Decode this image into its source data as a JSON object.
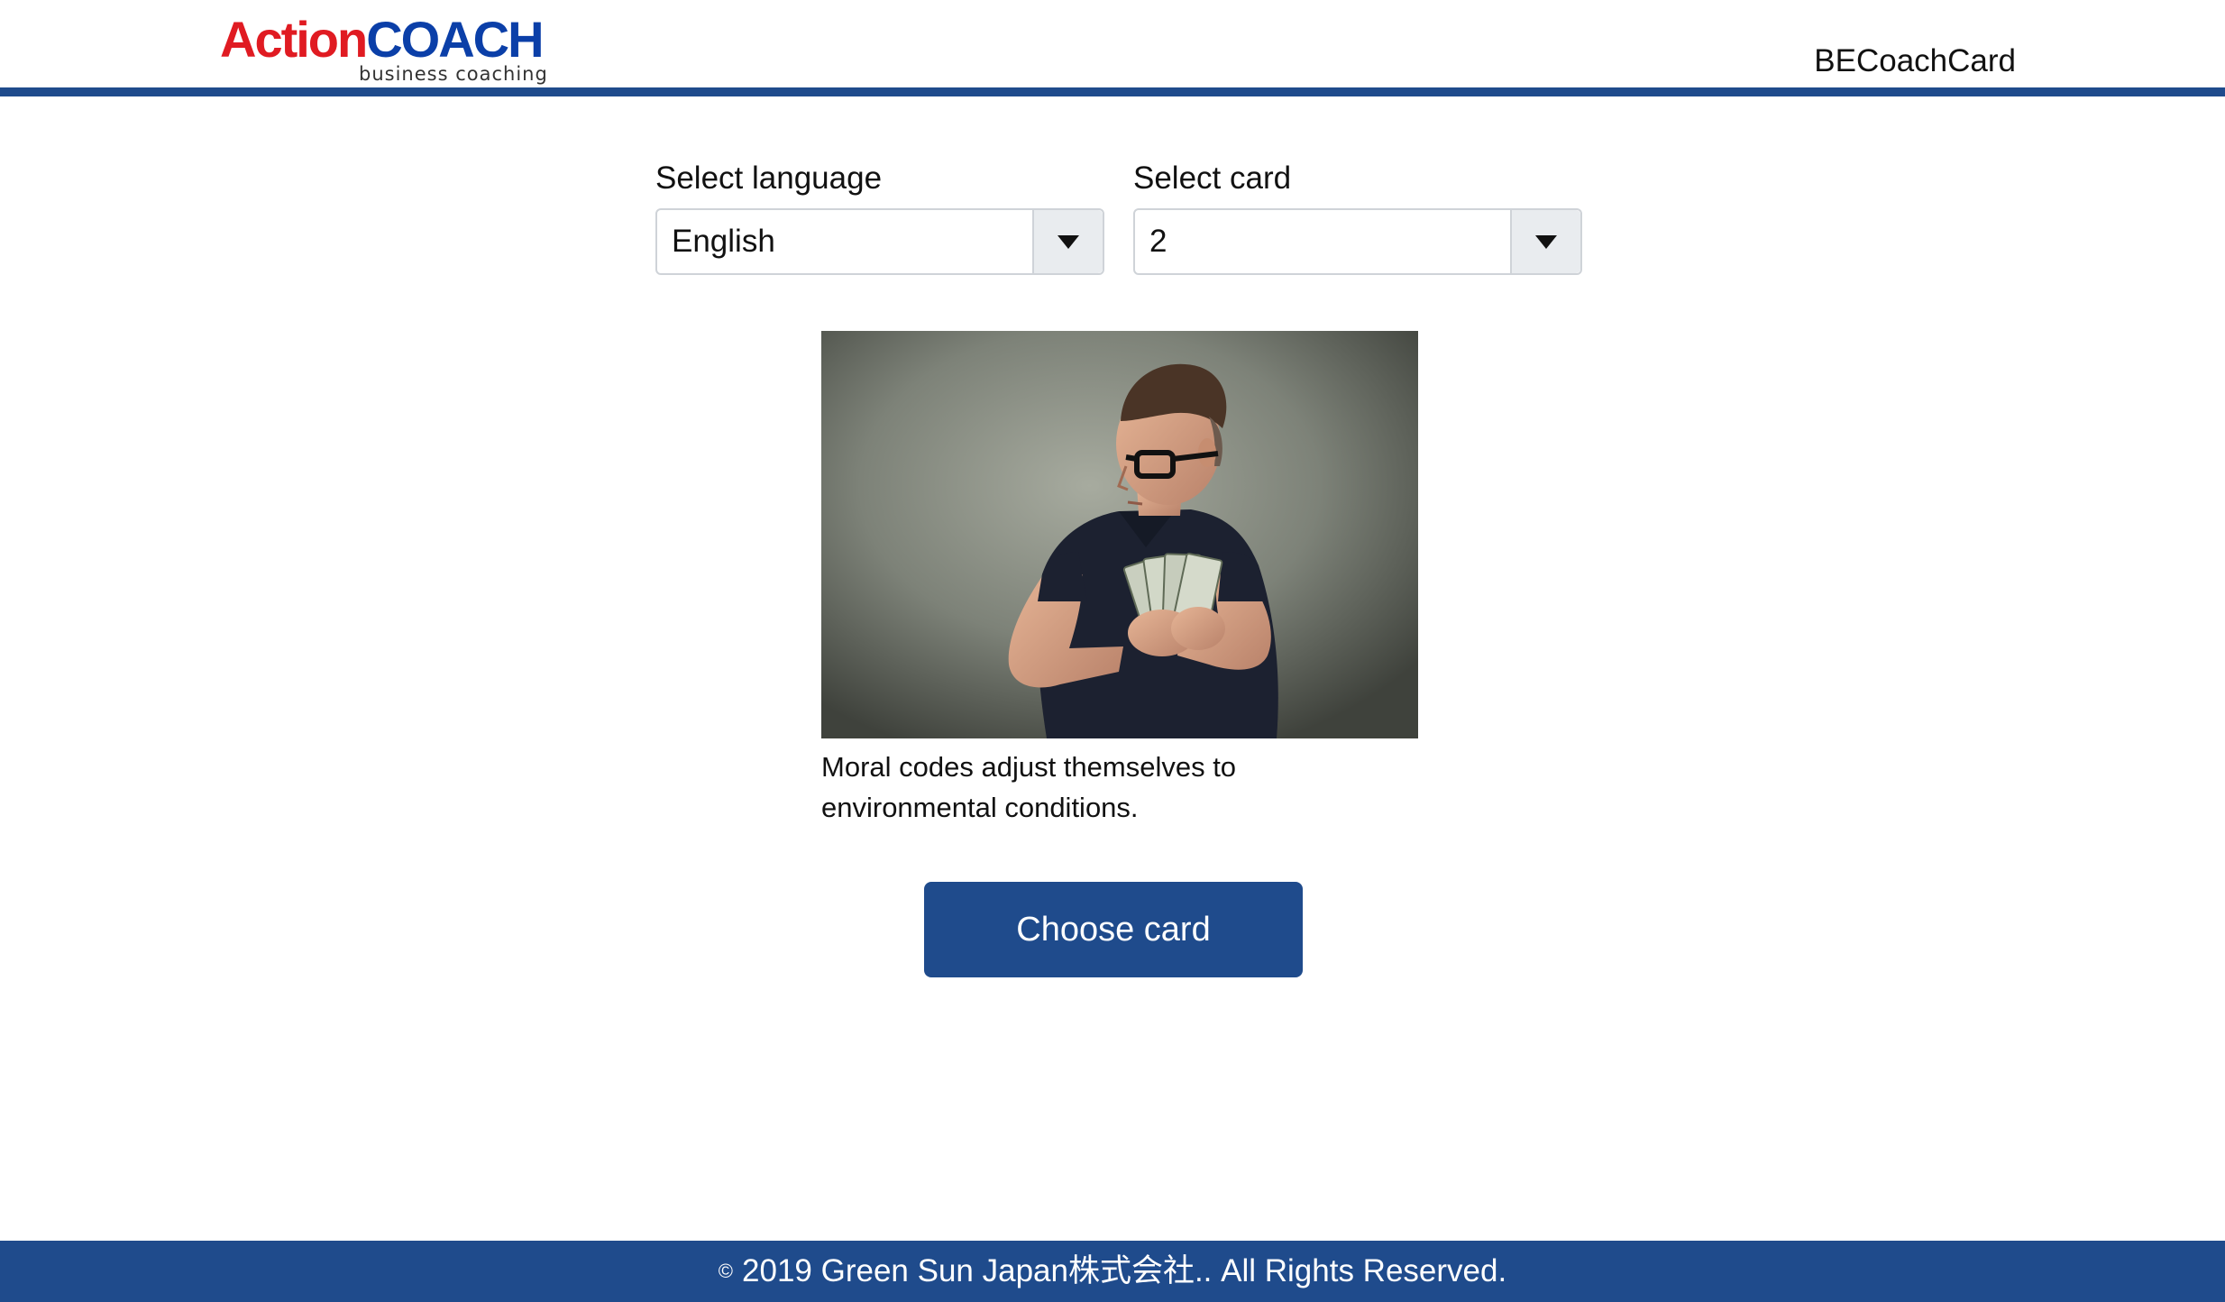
{
  "header": {
    "logo": {
      "word_action": "Action",
      "word_coach": "COACH",
      "tagline": "business coaching"
    },
    "app_name": "BECoachCard"
  },
  "form": {
    "language": {
      "label": "Select language",
      "selected": "English"
    },
    "card": {
      "label": "Select card",
      "selected": "2"
    }
  },
  "card": {
    "image_icon": "man-hiding-money-photo",
    "caption": "Moral codes adjust themselves to environmental conditions."
  },
  "actions": {
    "choose_label": "Choose card"
  },
  "footer": {
    "symbol": "©",
    "text": "2019 Green Sun Japan株式会社.. All Rights Reserved."
  },
  "colors": {
    "brand_blue": "#1f4b8c",
    "logo_red": "#e01b22",
    "logo_blue": "#0b3fa8",
    "select_arrow_bg": "#e9ecef"
  }
}
